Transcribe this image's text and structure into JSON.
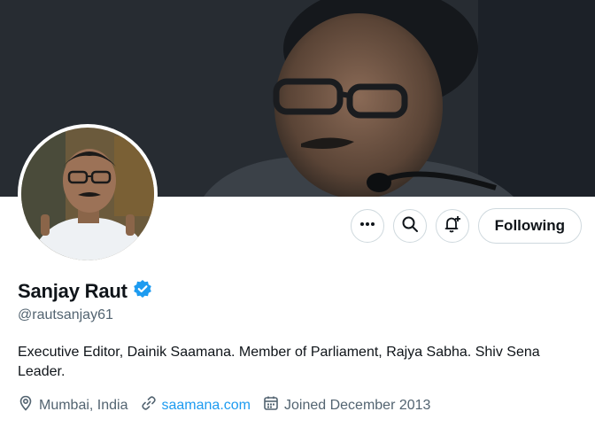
{
  "profile": {
    "name": "Sanjay Raut",
    "handle": "@rautsanjay61",
    "bio": "Executive Editor, Dainik Saamana. Member of Parliament, Rajya Sabha. Shiv Sena Leader.",
    "location": "Mumbai, India",
    "website": "saamana.com",
    "joined": "Joined December 2013",
    "verified": true
  },
  "actions": {
    "follow_label": "Following"
  },
  "colors": {
    "accent": "#1d9bf0",
    "muted": "#536471",
    "text": "#0f1419",
    "border": "#cfd9de"
  },
  "icons": {
    "more": "more-icon",
    "search": "search-icon",
    "notify": "notification-bell-icon",
    "verified": "verified-badge-icon",
    "location": "location-pin-icon",
    "link": "link-icon",
    "calendar": "calendar-icon"
  }
}
